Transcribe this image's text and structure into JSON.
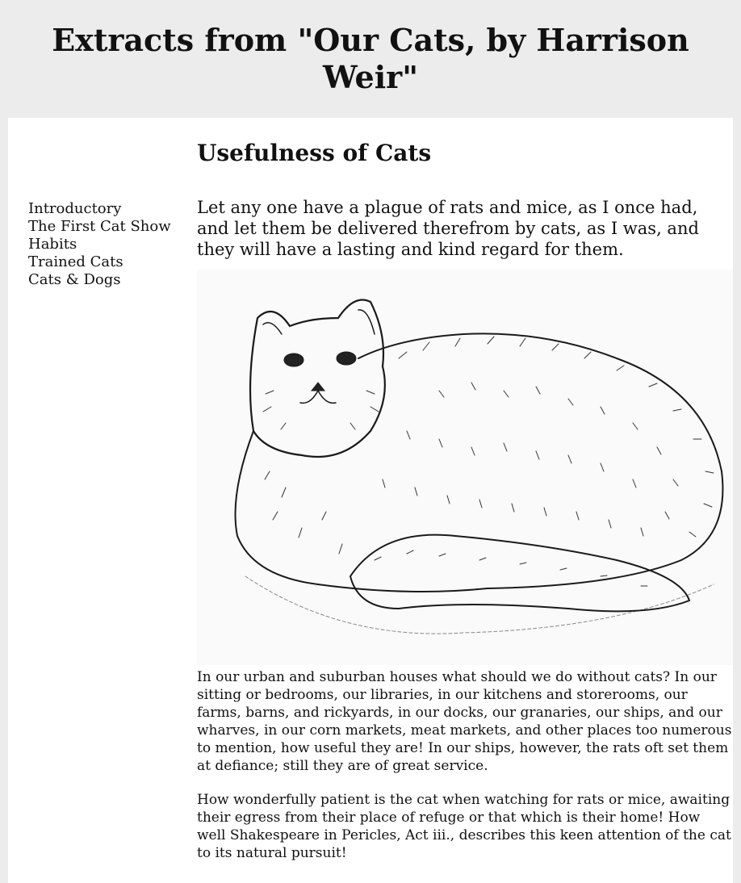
{
  "page_title": "Extracts from \"Our Cats, by Harrison Weir\"",
  "sidebar": {
    "items": [
      {
        "label": "Introductory"
      },
      {
        "label": "The First Cat Show"
      },
      {
        "label": "Habits"
      },
      {
        "label": "Trained Cats"
      },
      {
        "label": "Cats & Dogs"
      }
    ]
  },
  "article": {
    "heading": "Usefulness of Cats",
    "lead": "Let any one have a plague of rats and mice, as I once had, and let them be delivered therefrom by cats, as I was, and they will have a lasting and kind regard for them.",
    "paragraphs": [
      "In our urban and suburban houses what should we do without cats? In our sitting or bedrooms, our libraries, in our kitchens and storerooms, our farms, barns, and rickyards, in our docks, our granaries, our ships, and our wharves, in our corn markets, meat markets, and other places too numerous to mention, how useful they are! In our ships, however, the rats oft set them at defiance; still they are of great service.",
      "How wonderfully patient is the cat when watching for rats or mice, awaiting their egress from their place of refuge or that which is their home! How well Shakespeare in Pericles, Act iii., describes this keen attention of the cat to its natural pursuit!"
    ],
    "illustration_icon": "long-haired-cat-engraving"
  }
}
